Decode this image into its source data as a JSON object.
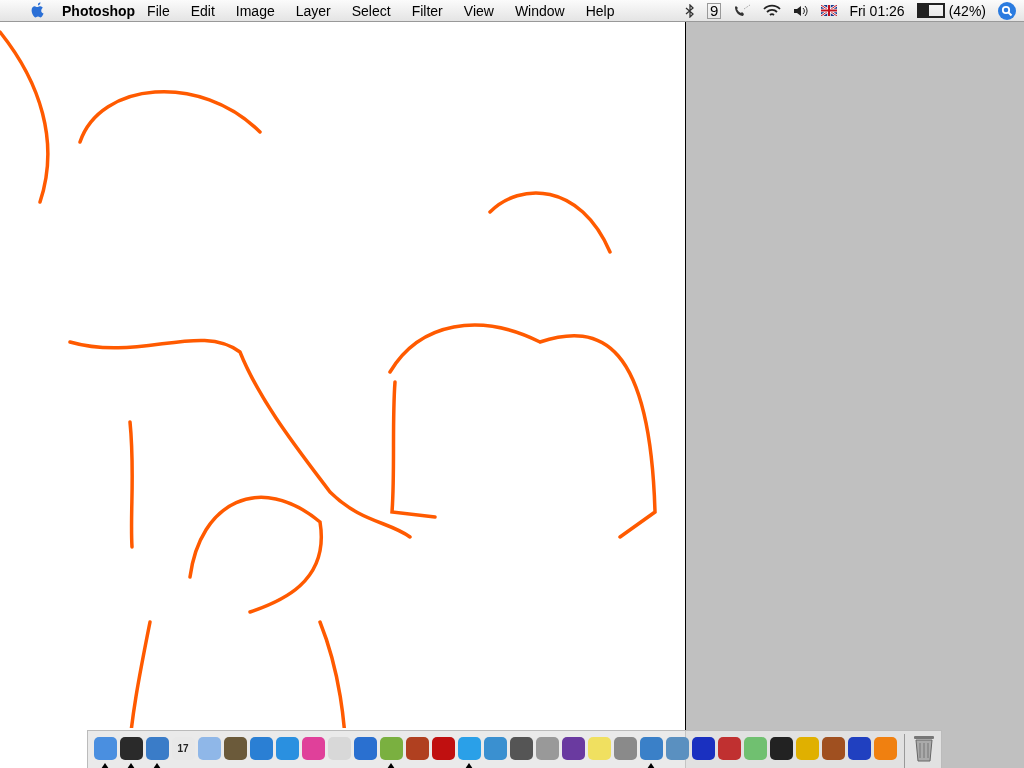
{
  "menu_bar": {
    "app_name": "Photoshop",
    "menus": [
      "File",
      "Edit",
      "Image",
      "Layer",
      "Select",
      "Filter",
      "View",
      "Window",
      "Help"
    ],
    "status_glyph": "9",
    "clock": "Fri 01:26",
    "battery": {
      "level": 0.42,
      "reading": "(42%)"
    }
  },
  "dock": {
    "apps": [
      {
        "color": "#4a8fe0",
        "running": true
      },
      {
        "color": "#2a2a2a",
        "running": true
      },
      {
        "color": "#3a7cc8",
        "running": true
      },
      {
        "color": "#e8e8e8",
        "running": false,
        "text": "17"
      },
      {
        "color": "#8fb7e8",
        "running": false
      },
      {
        "color": "#6b5a3a",
        "running": false
      },
      {
        "color": "#2a7fd4",
        "running": false
      },
      {
        "color": "#2a90e0",
        "running": false
      },
      {
        "color": "#e0409a",
        "running": false
      },
      {
        "color": "#d8d8d8",
        "running": false
      },
      {
        "color": "#2a70d0",
        "running": false
      },
      {
        "color": "#7ab040",
        "running": true
      },
      {
        "color": "#b04020",
        "running": false
      },
      {
        "color": "#c01010",
        "running": false
      },
      {
        "color": "#2aa0e8",
        "running": true
      },
      {
        "color": "#3a90d0",
        "running": false
      },
      {
        "color": "#555555",
        "running": false
      },
      {
        "color": "#999999",
        "running": false
      },
      {
        "color": "#6a3aa0",
        "running": false
      },
      {
        "color": "#f0e060",
        "running": false
      },
      {
        "color": "#8a8a8a",
        "running": false
      },
      {
        "color": "#3a80c8",
        "running": true
      },
      {
        "color": "#5a90c0",
        "running": false
      },
      {
        "color": "#1a30c0",
        "running": false
      },
      {
        "color": "#c03030",
        "running": false
      },
      {
        "color": "#70c070",
        "running": false
      },
      {
        "color": "#222222",
        "running": false
      },
      {
        "color": "#e0b000",
        "running": false
      },
      {
        "color": "#a05020",
        "running": false
      },
      {
        "color": "#2040c0",
        "running": false
      },
      {
        "color": "#f08010",
        "running": false
      }
    ]
  }
}
